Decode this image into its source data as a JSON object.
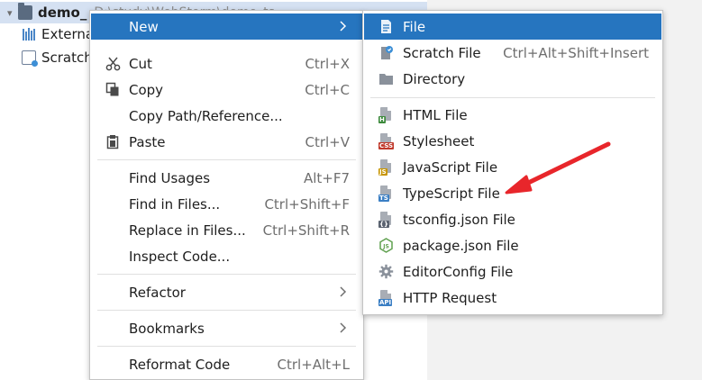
{
  "tree": {
    "rows": [
      {
        "label": "demo_",
        "path": "D:\\study\\WebStorm\\demo_ts"
      },
      {
        "label": "External Libraries"
      },
      {
        "label": "Scratches and Consoles"
      }
    ]
  },
  "main_menu": {
    "items": [
      {
        "label": "New",
        "shortcut": ""
      },
      {
        "label": "Cut",
        "shortcut": "Ctrl+X",
        "icon": "scissors-icon"
      },
      {
        "label": "Copy",
        "shortcut": "Ctrl+C",
        "icon": "copy-icon"
      },
      {
        "label": "Copy Path/Reference...",
        "shortcut": ""
      },
      {
        "label": "Paste",
        "shortcut": "Ctrl+V",
        "icon": "clipboard-icon"
      },
      {
        "label": "Find Usages",
        "shortcut": "Alt+F7"
      },
      {
        "label": "Find in Files...",
        "shortcut": "Ctrl+Shift+F"
      },
      {
        "label": "Replace in Files...",
        "shortcut": "Ctrl+Shift+R"
      },
      {
        "label": "Inspect Code...",
        "shortcut": ""
      },
      {
        "label": "Refactor",
        "shortcut": ""
      },
      {
        "label": "Bookmarks",
        "shortcut": ""
      },
      {
        "label": "Reformat Code",
        "shortcut": "Ctrl+Alt+L"
      }
    ]
  },
  "sub_menu": {
    "items": [
      {
        "label": "File",
        "shortcut": "",
        "icon": "file-icon"
      },
      {
        "label": "Scratch File",
        "shortcut": "Ctrl+Alt+Shift+Insert",
        "icon": "scratch-file-icon"
      },
      {
        "label": "Directory",
        "shortcut": "",
        "icon": "folder-icon"
      },
      {
        "label": "HTML File",
        "shortcut": "",
        "icon": "html-file-icon",
        "tag": "H"
      },
      {
        "label": "Stylesheet",
        "shortcut": "",
        "icon": "css-file-icon",
        "tag": "CSS"
      },
      {
        "label": "JavaScript File",
        "shortcut": "",
        "icon": "js-file-icon",
        "tag": "JS"
      },
      {
        "label": "TypeScript File",
        "shortcut": "",
        "icon": "ts-file-icon",
        "tag": "TS"
      },
      {
        "label": "tsconfig.json File",
        "shortcut": "",
        "icon": "tsconfig-file-icon",
        "tag": "{}"
      },
      {
        "label": "package.json File",
        "shortcut": "",
        "icon": "nodejs-icon",
        "tag": "JS"
      },
      {
        "label": "EditorConfig File",
        "shortcut": "",
        "icon": "gear-icon"
      },
      {
        "label": "HTTP Request",
        "shortcut": "",
        "icon": "http-request-icon",
        "tag": "API"
      }
    ]
  },
  "colors": {
    "highlight": "#2675bf",
    "arrow": "#e8262b",
    "html_tag": "#3c8a3c",
    "css_tag": "#c0392b",
    "js_tag": "#c79500",
    "ts_tag": "#3b7fc4",
    "api_tag": "#3b7fc4"
  }
}
